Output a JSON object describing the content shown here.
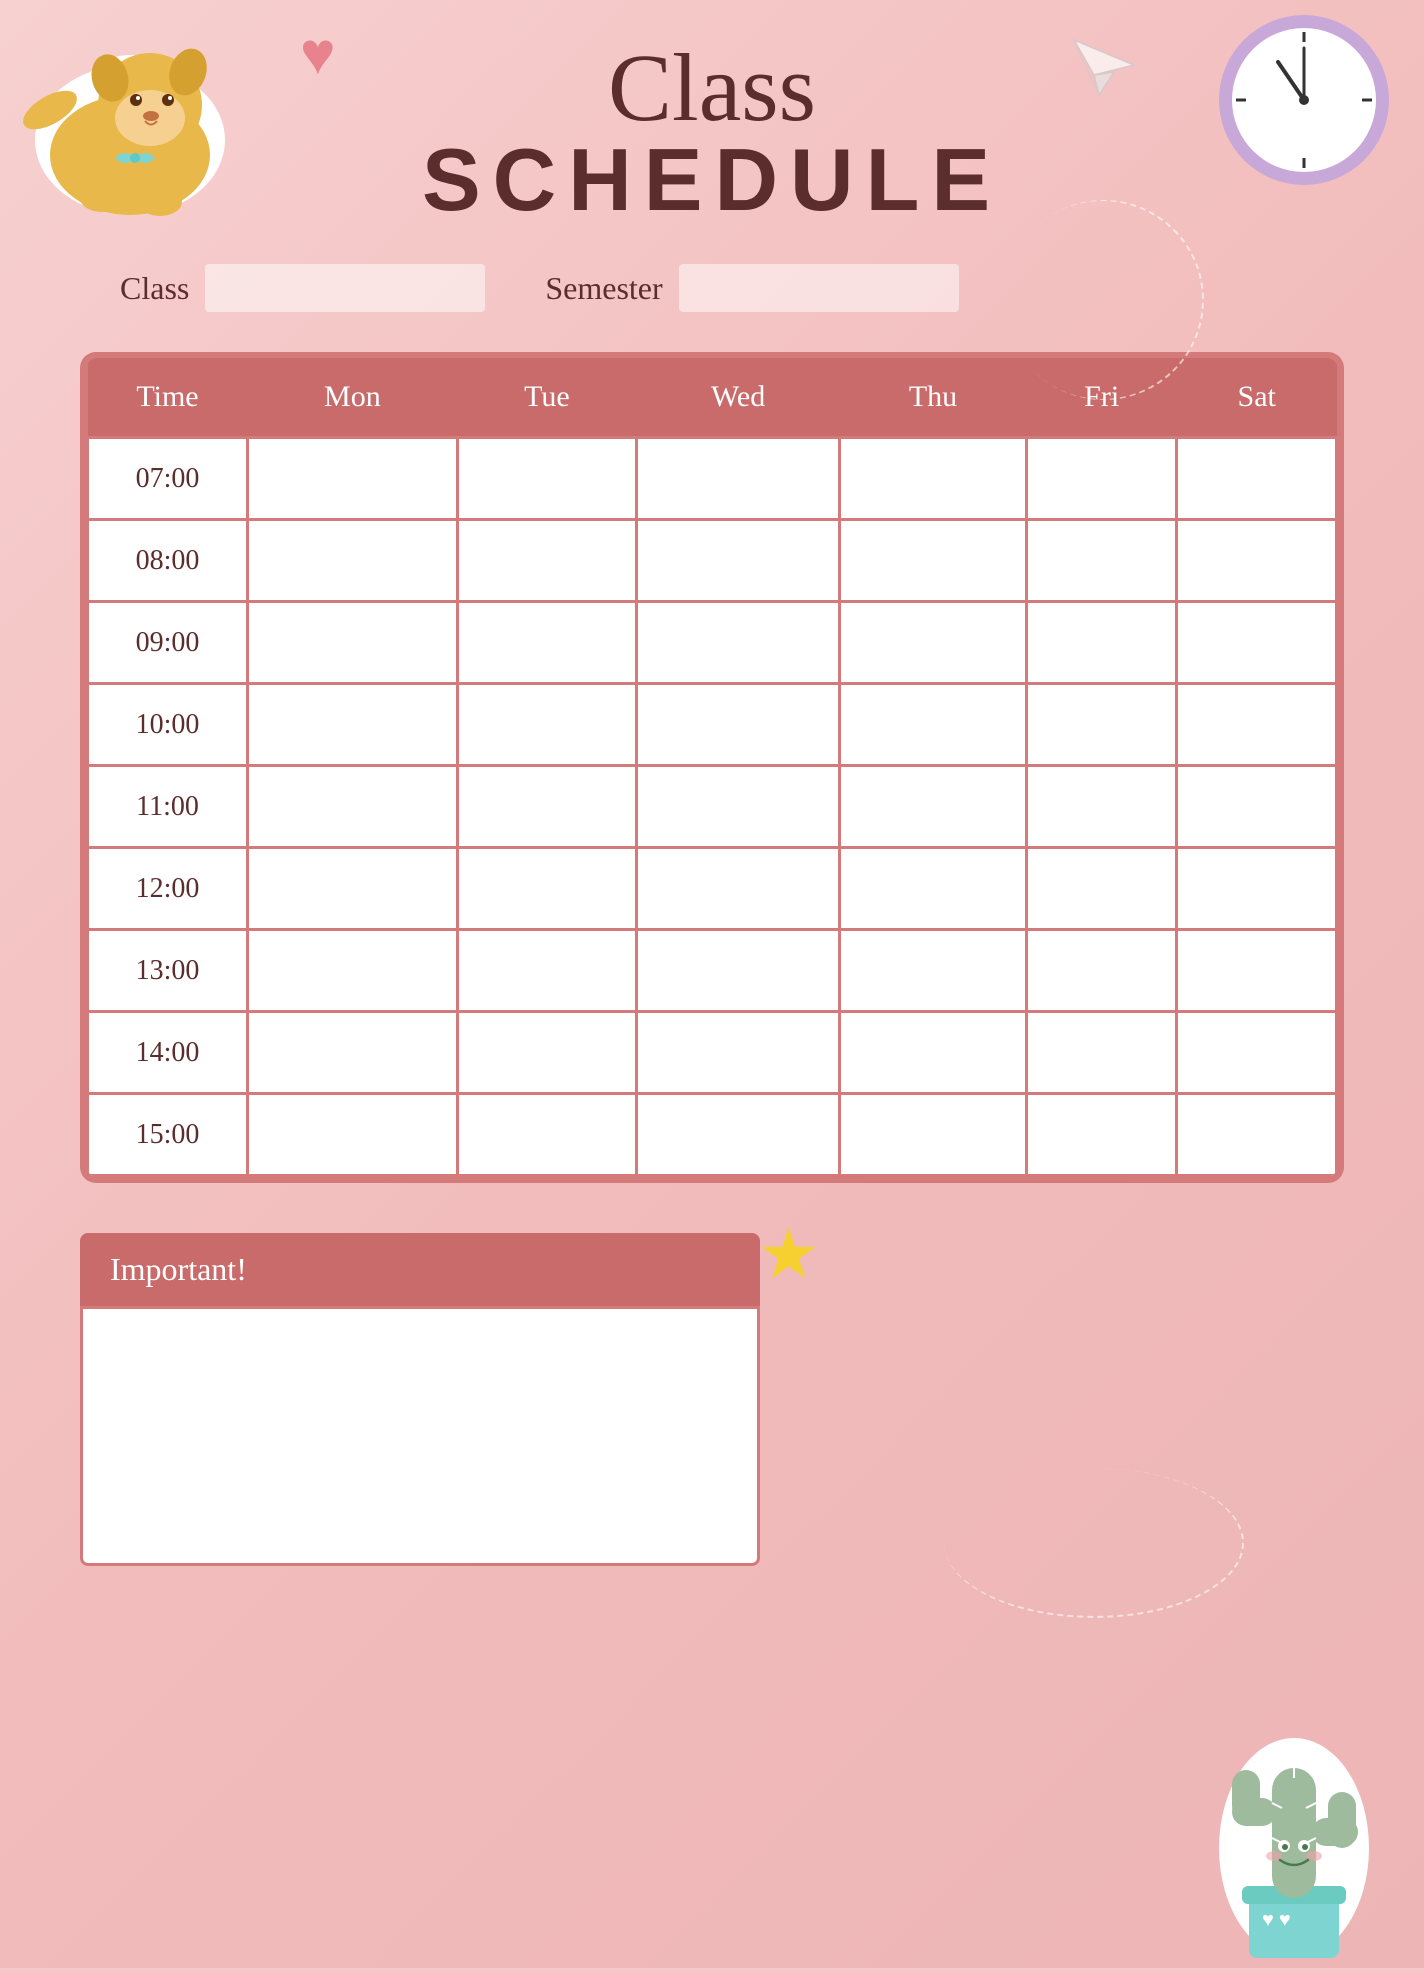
{
  "header": {
    "title_cursive": "Class",
    "title_bold": "SCHEDULE"
  },
  "form": {
    "class_label": "Class",
    "semester_label": "Semester"
  },
  "table": {
    "headers": [
      "Time",
      "Mon",
      "Tue",
      "Wed",
      "Thu",
      "Fri",
      "Sat"
    ],
    "times": [
      "07:00",
      "08:00",
      "09:00",
      "10:00",
      "11:00",
      "12:00",
      "13:00",
      "14:00",
      "15:00"
    ]
  },
  "important": {
    "header_label": "Important!"
  },
  "colors": {
    "bg": "#f5c8c8",
    "header_bg": "#c96b6b",
    "table_border": "#d47a7a",
    "text_dark": "#5c2d2d",
    "text_white": "#ffffff"
  }
}
